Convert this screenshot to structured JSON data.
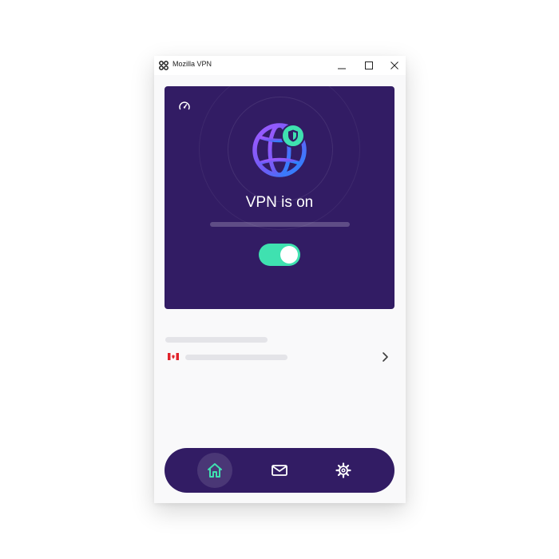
{
  "window": {
    "title": "Mozilla VPN",
    "app_icon": "mozilla-vpn-logo-icon",
    "controls": [
      "minimize-icon",
      "maximize-icon",
      "close-icon"
    ]
  },
  "hero": {
    "status_title": "VPN is on",
    "toggle_state": "on",
    "icons": [
      "speed-gauge-icon",
      "globe-icon",
      "shield-icon"
    ]
  },
  "location": {
    "flag_icon": "canada-flag-icon",
    "chevron_icon": "chevron-right-icon"
  },
  "navbar": {
    "items": [
      "home-icon",
      "messages-icon",
      "settings-icon"
    ],
    "active": "home-icon"
  },
  "colors": {
    "brand_purple": "#321c64",
    "toggle_on": "#3fe1b0",
    "active_home": "#3fe1b0",
    "background": "#f9f9fa"
  }
}
